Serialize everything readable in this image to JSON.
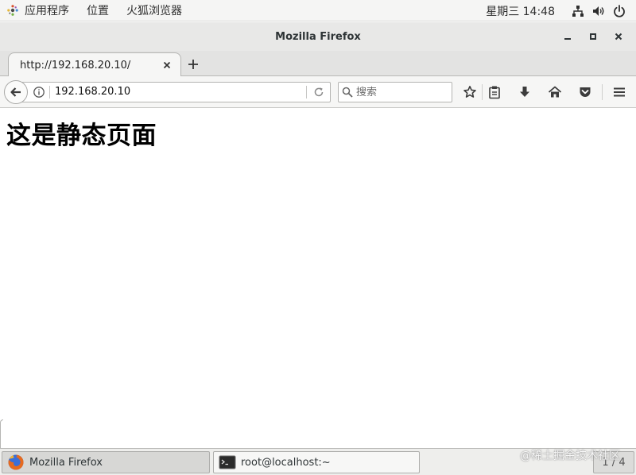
{
  "topbar": {
    "apps_label": "应用程序",
    "places_label": "位置",
    "firefox_label": "火狐浏览器",
    "clock": "星期三 14:48"
  },
  "window": {
    "title": "Mozilla Firefox"
  },
  "tab": {
    "title": "http://192.168.20.10/"
  },
  "navbar": {
    "url": "192.168.20.10",
    "search_placeholder": "搜索"
  },
  "page": {
    "heading": "这是静态页面"
  },
  "taskbar": {
    "firefox_task": "Mozilla Firefox",
    "terminal_task": "root@localhost:~",
    "workspace": "1 / 4"
  },
  "watermark": "@稀土掘金技术社区",
  "colors": {
    "topbar_bg": "#f5f5f4",
    "titlebar_bg": "#e8e8e7",
    "toolbar_bg": "#f6f6f5",
    "taskbar_bg": "#eeeeec",
    "icon_dark": "#3c3c3c"
  },
  "icons": {
    "apps": "gnome-foot-icon",
    "network": "network-icon",
    "volume": "volume-icon",
    "power": "power-icon",
    "minimize": "minimize-icon",
    "maximize": "maximize-icon",
    "close": "close-icon",
    "back": "back-arrow-icon",
    "info": "info-icon",
    "reload": "reload-icon",
    "search": "search-icon",
    "bookmark": "star-icon",
    "library": "clipboard-icon",
    "download": "download-icon",
    "home": "home-icon",
    "pocket": "pocket-icon",
    "menu": "hamburger-menu-icon"
  }
}
